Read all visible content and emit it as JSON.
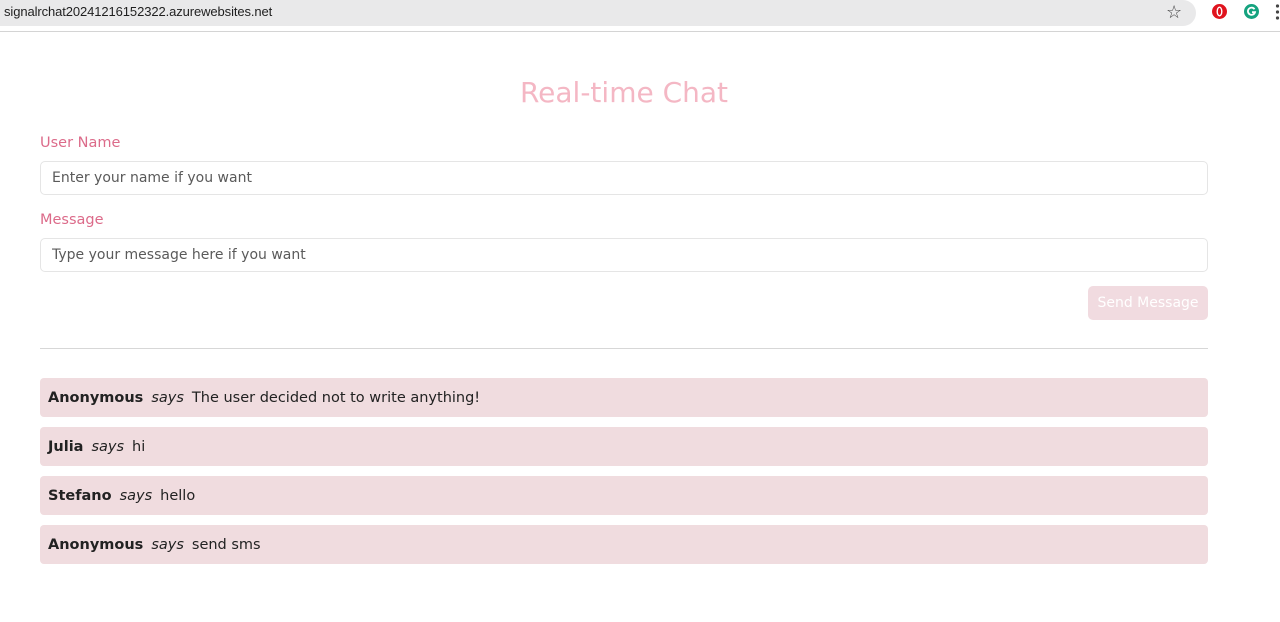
{
  "browser": {
    "url": "signalrchat20241216152322.azurewebsites.net",
    "star_glyph": "☆"
  },
  "page": {
    "title": "Real-time Chat"
  },
  "form": {
    "user_label": "User Name",
    "user_placeholder": "Enter your name if you want",
    "user_value": "",
    "message_label": "Message",
    "message_placeholder": "Type your message here if you want",
    "message_value": "",
    "send_label": "Send Message"
  },
  "messages": [
    {
      "user": "Anonymous",
      "says": "says",
      "text": "The user decided not to write anything!"
    },
    {
      "user": "Julia",
      "says": "says",
      "text": "hi"
    },
    {
      "user": "Stefano",
      "says": "says",
      "text": "hello"
    },
    {
      "user": "Anonymous",
      "says": "says",
      "text": "send sms"
    }
  ],
  "colors": {
    "title": "#f4b7c4",
    "label": "#dc6b8a",
    "button_bg": "#f1dbe0",
    "message_bg": "#f0dcdf"
  },
  "icons": {
    "bookmark": "star-icon",
    "extension_1": "opera-icon",
    "extension_2": "grammarly-icon",
    "menu": "menu-dots-icon"
  }
}
